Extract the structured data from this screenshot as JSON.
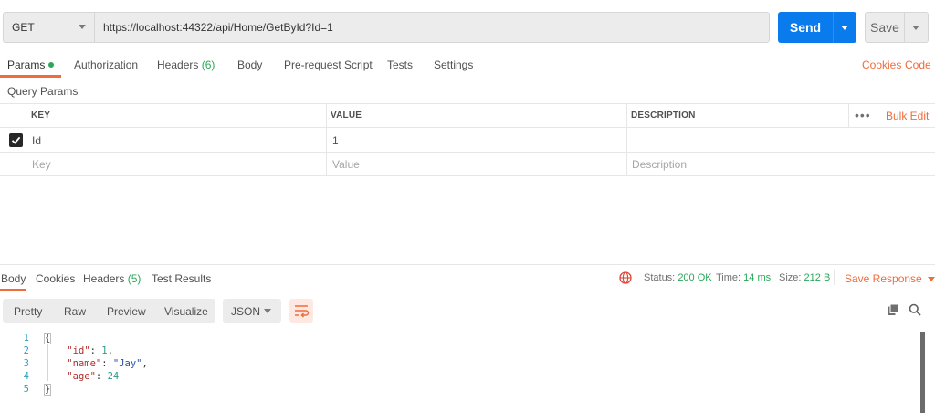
{
  "request": {
    "method": "GET",
    "url": "https://localhost:44322/api/Home/GetById?Id=1",
    "send_label": "Send",
    "save_label": "Save"
  },
  "request_tabs": [
    {
      "label": "Params"
    },
    {
      "label": "Authorization"
    },
    {
      "label": "Headers",
      "count": "(6)"
    },
    {
      "label": "Body"
    },
    {
      "label": "Pre-request Script"
    },
    {
      "label": "Tests"
    },
    {
      "label": "Settings"
    }
  ],
  "request_links": {
    "cookies": "Cookies",
    "code": "Code"
  },
  "query_params": {
    "title": "Query Params",
    "headers": {
      "key": "KEY",
      "value": "VALUE",
      "description": "DESCRIPTION",
      "bulk_edit": "Bulk Edit"
    },
    "rows": [
      {
        "key": "Id",
        "value": "1",
        "description": "",
        "checked": true
      }
    ],
    "placeholders": {
      "key": "Key",
      "value": "Value",
      "description": "Description"
    }
  },
  "response": {
    "tabs": [
      {
        "label": "Body"
      },
      {
        "label": "Cookies"
      },
      {
        "label": "Headers",
        "count": "(5)"
      },
      {
        "label": "Test Results"
      }
    ],
    "status_label": "Status:",
    "status_value": "200 OK",
    "time_label": "Time:",
    "time_value": "14 ms",
    "size_label": "Size:",
    "size_value": "212 B",
    "save_response": "Save Response",
    "view_modes": [
      "Pretty",
      "Raw",
      "Preview",
      "Visualize"
    ],
    "format": "JSON",
    "line_numbers": [
      "1",
      "2",
      "3",
      "4",
      "5"
    ],
    "body": {
      "open": "{",
      "close": "}",
      "fields": [
        {
          "key": "\"id\"",
          "value": "1",
          "type": "number",
          "comma": ","
        },
        {
          "key": "\"name\"",
          "value": "\"Jay\"",
          "type": "string",
          "comma": ","
        },
        {
          "key": "\"age\"",
          "value": "24",
          "type": "number",
          "comma": ""
        }
      ]
    }
  },
  "colors": {
    "accent": "#f26b3a",
    "send_blue": "#097bed",
    "status_green": "#2aa75a"
  }
}
